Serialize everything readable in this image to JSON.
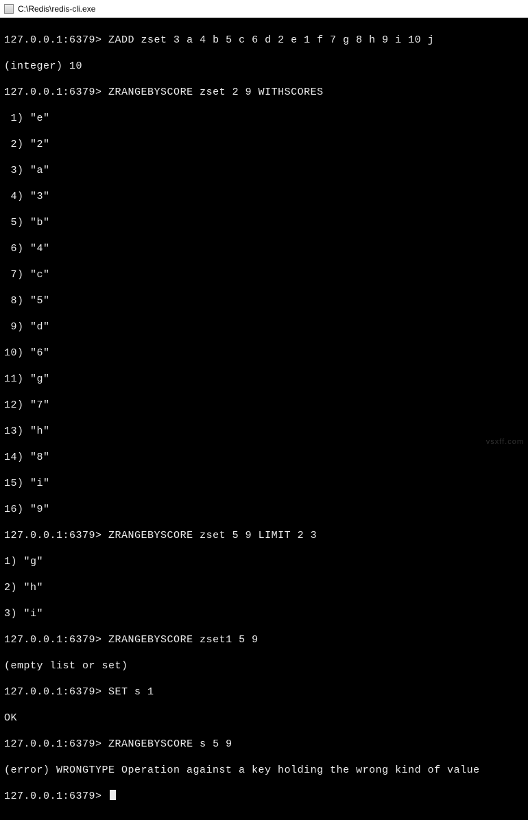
{
  "window": {
    "title": "C:\\Redis\\redis-cli.exe"
  },
  "prompt": "127.0.0.1:6379>",
  "session": {
    "cmd1": "ZADD zset 3 a 4 b 5 c 6 d 2 e 1 f 7 g 8 h 9 i 10 j",
    "out1": "(integer) 10",
    "cmd2": "ZRANGEBYSCORE zset 2 9 WITHSCORES",
    "out2": [
      " 1) \"e\"",
      " 2) \"2\"",
      " 3) \"a\"",
      " 4) \"3\"",
      " 5) \"b\"",
      " 6) \"4\"",
      " 7) \"c\"",
      " 8) \"5\"",
      " 9) \"d\"",
      "10) \"6\"",
      "11) \"g\"",
      "12) \"7\"",
      "13) \"h\"",
      "14) \"8\"",
      "15) \"i\"",
      "16) \"9\""
    ],
    "cmd3": "ZRANGEBYSCORE zset 5 9 LIMIT 2 3",
    "out3": [
      "1) \"g\"",
      "2) \"h\"",
      "3) \"i\""
    ],
    "cmd4": "ZRANGEBYSCORE zset1 5 9",
    "out4": "(empty list or set)",
    "cmd5": "SET s 1",
    "out5": "OK",
    "cmd6": "ZRANGEBYSCORE s 5 9",
    "out6": "(error) WRONGTYPE Operation against a key holding the wrong kind of value"
  },
  "watermark": "vsxff.com"
}
